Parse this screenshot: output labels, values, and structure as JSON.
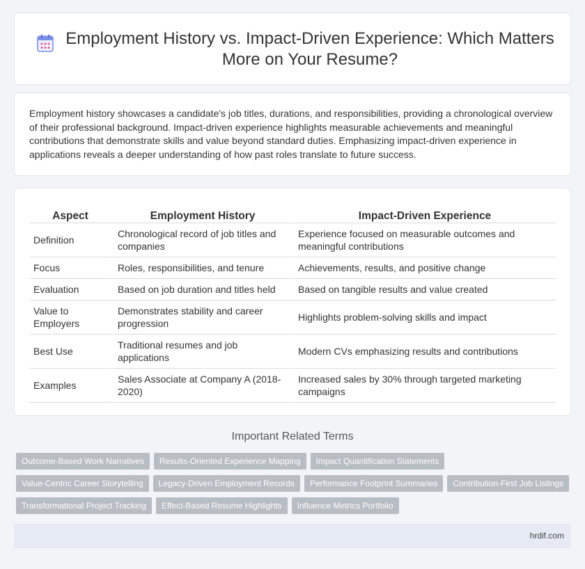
{
  "header": {
    "title": "Employment History vs. Impact-Driven Experience: Which Matters More on Your Resume?",
    "icon": "calendar-icon"
  },
  "intro": {
    "text": "Employment history showcases a candidate's job titles, durations, and responsibilities, providing a chronological overview of their professional background. Impact-driven experience highlights measurable achievements and meaningful contributions that demonstrate skills and value beyond standard duties. Emphasizing impact-driven experience in applications reveals a deeper understanding of how past roles translate to future success."
  },
  "table": {
    "headers": [
      "Aspect",
      "Employment History",
      "Impact-Driven Experience"
    ],
    "rows": [
      [
        "Definition",
        "Chronological record of job titles and companies",
        "Experience focused on measurable outcomes and meaningful contributions"
      ],
      [
        "Focus",
        "Roles, responsibilities, and tenure",
        "Achievements, results, and positive change"
      ],
      [
        "Evaluation",
        "Based on job duration and titles held",
        "Based on tangible results and value created"
      ],
      [
        "Value to Employers",
        "Demonstrates stability and career progression",
        "Highlights problem-solving skills and impact"
      ],
      [
        "Best Use",
        "Traditional resumes and job applications",
        "Modern CVs emphasizing results and contributions"
      ],
      [
        "Examples",
        "Sales Associate at Company A (2018-2020)",
        "Increased sales by 30% through targeted marketing campaigns"
      ]
    ]
  },
  "related": {
    "title": "Important Related Terms",
    "tags": [
      "Outcome-Based Work Narratives",
      "Results-Oriented Experience Mapping",
      "Impact Quantification Statements",
      "Value-Centric Career Storytelling",
      "Legacy-Driven Employment Records",
      "Performance Footprint Summaries",
      "Contribution-First Job Listings",
      "Transformational Project Tracking",
      "Effect-Based Resume Highlights",
      "Influence Metrics Portfolio"
    ]
  },
  "footer": {
    "site": "hrdif.com"
  },
  "colors": {
    "icon_accent": "#7b8fe8",
    "icon_dots": "#e05a8a",
    "tag_bg": "#b8bcc3"
  }
}
